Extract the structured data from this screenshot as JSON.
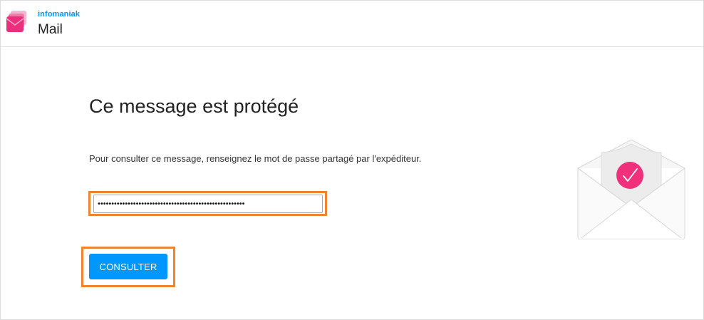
{
  "header": {
    "brand": "infomaniak",
    "app_name": "Mail"
  },
  "main": {
    "title": "Ce message est protégé",
    "instruction": "Pour consulter ce message, renseignez le mot de passe partagé par l'expéditeur.",
    "password_value": "••••••••••••••••••••••••••••••••••••••••••••••••••••••",
    "submit_label": "CONSULTER"
  },
  "icons": {
    "logo": "infomaniak-mail-logo-icon",
    "illustration": "protected-envelope-icon",
    "badge": "checkmark-icon"
  },
  "colors": {
    "accent": "#0098ff",
    "highlight": "#f0852d",
    "badge": "#f1307b"
  }
}
